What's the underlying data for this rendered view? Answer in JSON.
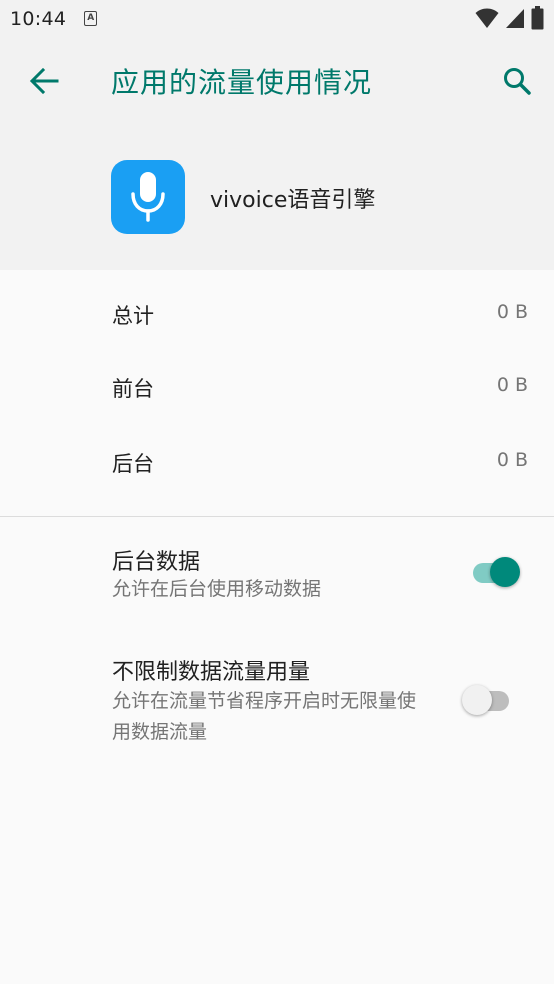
{
  "status_bar": {
    "time": "10:44",
    "notification_icon": "A"
  },
  "header": {
    "title": "应用的流量使用情况",
    "accent_color": "#00796b"
  },
  "app": {
    "name": "vivoice语音引擎",
    "icon": "microphone-icon",
    "icon_color": "#1a9ff3"
  },
  "usage": {
    "total_label": "总计",
    "total_value": "0 B",
    "foreground_label": "前台",
    "foreground_value": "0 B",
    "background_label": "后台",
    "background_value": "0 B"
  },
  "settings": {
    "background_data": {
      "title": "后台数据",
      "subtitle": "允许在后台使用移动数据",
      "enabled": true
    },
    "unrestricted": {
      "title": "不限制数据流量用量",
      "subtitle": "允许在流量节省程序开启时无限量使用数据流量",
      "enabled": false
    }
  }
}
